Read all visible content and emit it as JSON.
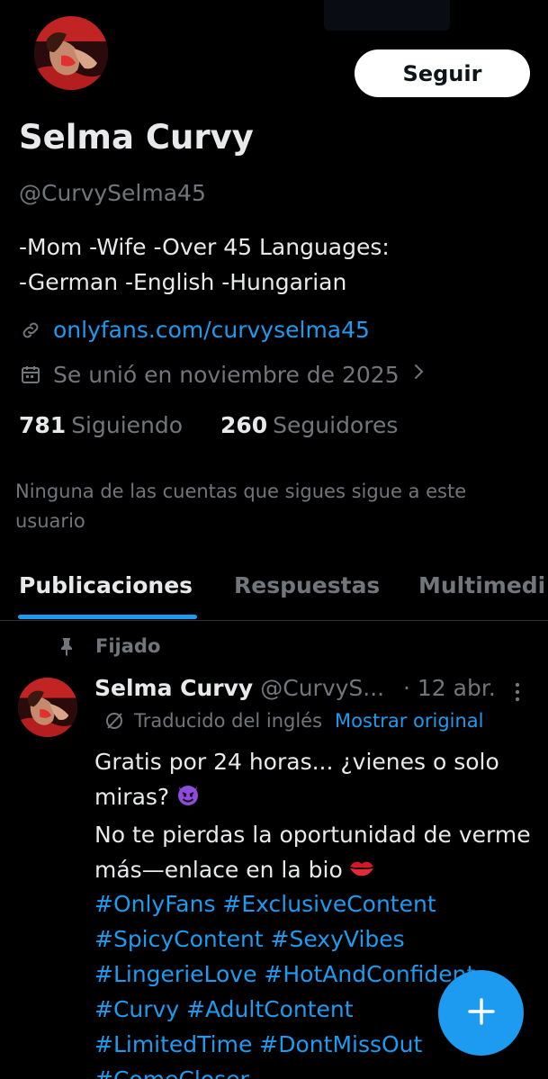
{
  "profile": {
    "name": "Selma Curvy",
    "handle": "@CurvySelma45",
    "bio": "-Mom -Wife -Over 45  Languages:\n-German -English -Hungarian",
    "link": "onlyfans.com/curvyselma45",
    "joined": "Se unió en noviembre de 2025",
    "following_count": "781",
    "following_label": "Siguiendo",
    "followers_count": "260",
    "followers_label": "Seguidores",
    "followers_note": "Ninguna de las cuentas que sigues sigue a este usuario"
  },
  "follow_button": {
    "label": "Seguir"
  },
  "tabs": [
    {
      "label": "Publicaciones",
      "active": true
    },
    {
      "label": "Respuestas",
      "active": false
    },
    {
      "label": "Multimedi",
      "active": false
    }
  ],
  "pinned_post": {
    "pinned_label": "Fijado",
    "author_name": "Selma Curvy",
    "author_handle": "@CurvyS...",
    "time": "· 12 abr.",
    "translated_label": "Traducido del inglés",
    "show_original_label": "Mostrar original",
    "text_line1": "Gratis por 24 horas... ¿vienes o solo miras?",
    "text_line2": "No te pierdas la oportunidad de verme más—enlace en la bio",
    "hashtag_lines": [
      "#OnlyFans #ExclusiveContent",
      "#SpicyContent #SexyVibes",
      "#LingerieLove #HotAndConfident",
      "#Curvy #AdultContent",
      "#LimitedTime #DontMissOut",
      "#ComeCloser"
    ]
  },
  "icons": {
    "link": "link-icon",
    "calendar": "calendar-icon",
    "chevron": "chevron-right-icon",
    "pin": "pin-icon",
    "translate": "translate-icon",
    "more": "more-vertical-icon",
    "compose": "plus-icon"
  },
  "colors": {
    "background": "#000000",
    "accent": "#1d9bf0",
    "text_primary": "#e7e9ea",
    "text_secondary": "#71767b"
  }
}
